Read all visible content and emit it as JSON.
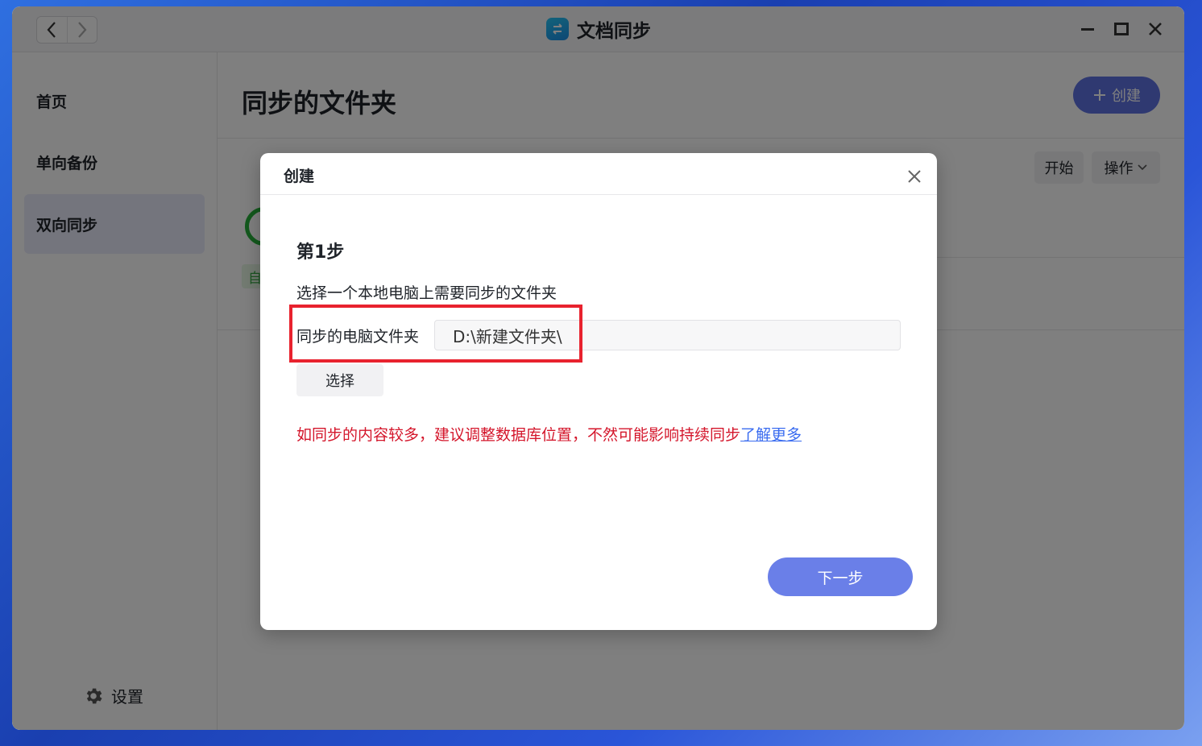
{
  "app": {
    "title": "文档同步",
    "accent_color": "#5f73e3"
  },
  "titlebar": {
    "back_icon": "chevron-left-icon",
    "forward_icon": "chevron-right-icon",
    "minimize_icon": "minimize-icon",
    "maximize_icon": "maximize-icon",
    "close_icon": "close-icon"
  },
  "sidebar": {
    "items": [
      {
        "label": "首页",
        "active": false
      },
      {
        "label": "单向备份",
        "active": false
      },
      {
        "label": "双向同步",
        "active": true
      }
    ],
    "settings_label": "设置",
    "settings_icon": "gear-icon"
  },
  "main": {
    "title": "同步的文件夹",
    "create_label": "创建",
    "start_label": "开始",
    "ops_label": "操作",
    "auto_badge": "自"
  },
  "modal": {
    "title": "创建",
    "step_title": "第1步",
    "step_desc": "选择一个本地电脑上需要同步的文件夹",
    "field_label": "同步的电脑文件夹",
    "field_value": "D:\\新建文件夹\\",
    "select_label": "选择",
    "warning_text": "如同步的内容较多，建议调整数据库位置，不然可能影响持续同步",
    "warning_link": "了解更多",
    "next_label": "下一步",
    "highlight_color": "#e8222e"
  }
}
